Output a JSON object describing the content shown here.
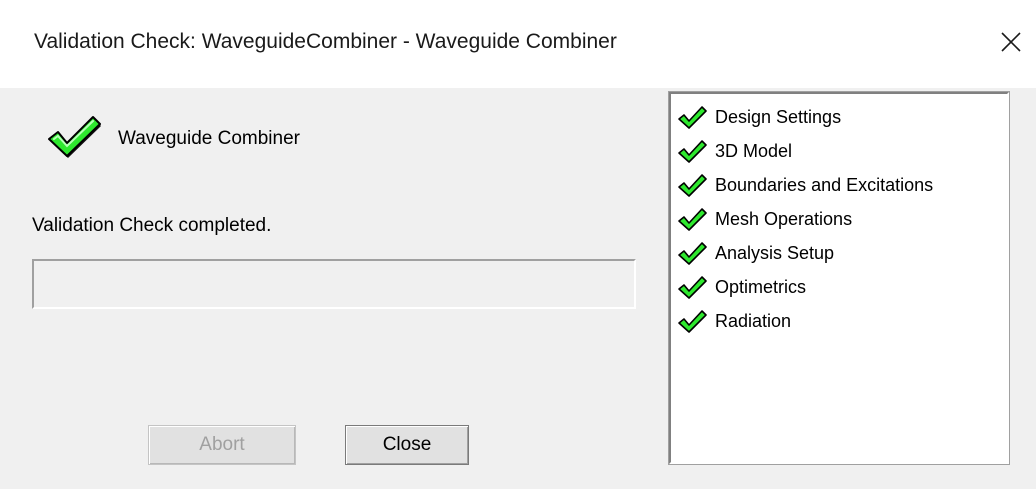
{
  "window": {
    "title": "Validation Check: WaveguideCombiner - Waveguide Combiner",
    "close_icon": "close-icon"
  },
  "design": {
    "name": "Waveguide Combiner",
    "status_icon": "checkmark-icon"
  },
  "status": {
    "message": "Validation Check completed.",
    "progress": 0
  },
  "buttons": {
    "abort_label": "Abort",
    "abort_enabled": false,
    "close_label": "Close"
  },
  "checks": {
    "items": [
      {
        "label": "Design Settings",
        "icon": "checkmark-icon"
      },
      {
        "label": "3D Model",
        "icon": "checkmark-icon"
      },
      {
        "label": "Boundaries and Excitations",
        "icon": "checkmark-icon"
      },
      {
        "label": "Mesh Operations",
        "icon": "checkmark-icon"
      },
      {
        "label": "Analysis Setup",
        "icon": "checkmark-icon"
      },
      {
        "label": "Optimetrics",
        "icon": "checkmark-icon"
      },
      {
        "label": "Radiation",
        "icon": "checkmark-icon"
      }
    ]
  },
  "colors": {
    "check_green": "#2ee82e",
    "check_outline": "#000000",
    "disabled_text": "#a0a0a0"
  }
}
